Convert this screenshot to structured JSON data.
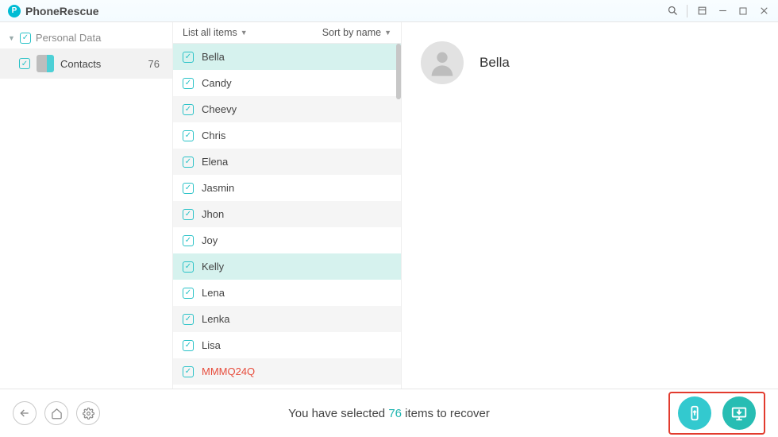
{
  "app": {
    "title": "PhoneRescue"
  },
  "sidebar": {
    "root_label": "Personal Data",
    "items": [
      {
        "label": "Contacts",
        "count": "76"
      }
    ]
  },
  "list": {
    "header": {
      "list_label": "List all items",
      "sort_label": "Sort by name"
    },
    "rows": [
      {
        "name": "Bella",
        "selected": true
      },
      {
        "name": "Candy"
      },
      {
        "name": "Cheevy"
      },
      {
        "name": "Chris"
      },
      {
        "name": "Elena"
      },
      {
        "name": "Jasmin"
      },
      {
        "name": "Jhon"
      },
      {
        "name": "Joy"
      },
      {
        "name": "Kelly",
        "selected": true
      },
      {
        "name": "Lena"
      },
      {
        "name": "Lenka"
      },
      {
        "name": "Lisa"
      },
      {
        "name": "MMMQ24Q",
        "special": true
      }
    ]
  },
  "detail": {
    "name": "Bella"
  },
  "footer": {
    "text_before": "You have selected ",
    "count": "76",
    "text_after": " items to recover"
  }
}
